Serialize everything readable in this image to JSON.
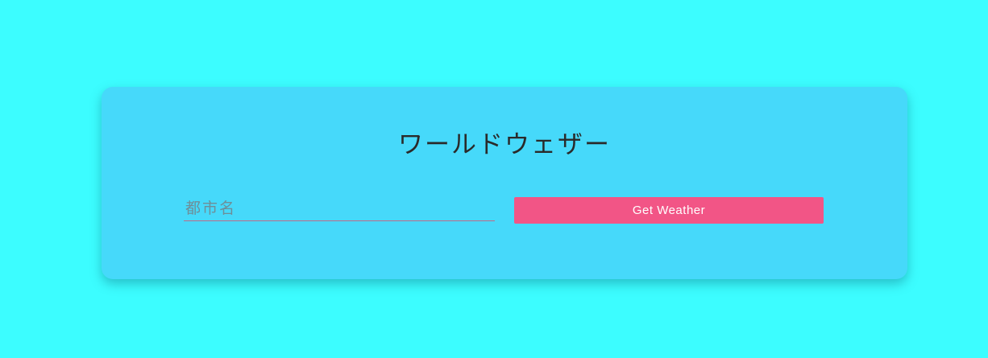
{
  "app": {
    "title": "ワールドウェザー"
  },
  "form": {
    "city_placeholder": "都市名",
    "city_value": "",
    "submit_label": "Get Weather"
  },
  "colors": {
    "page_background": "#3cfdff",
    "card_background": "#46d9fa",
    "button_background": "#f25586",
    "button_text": "#ffffff",
    "title_text": "#2a2a2a"
  }
}
